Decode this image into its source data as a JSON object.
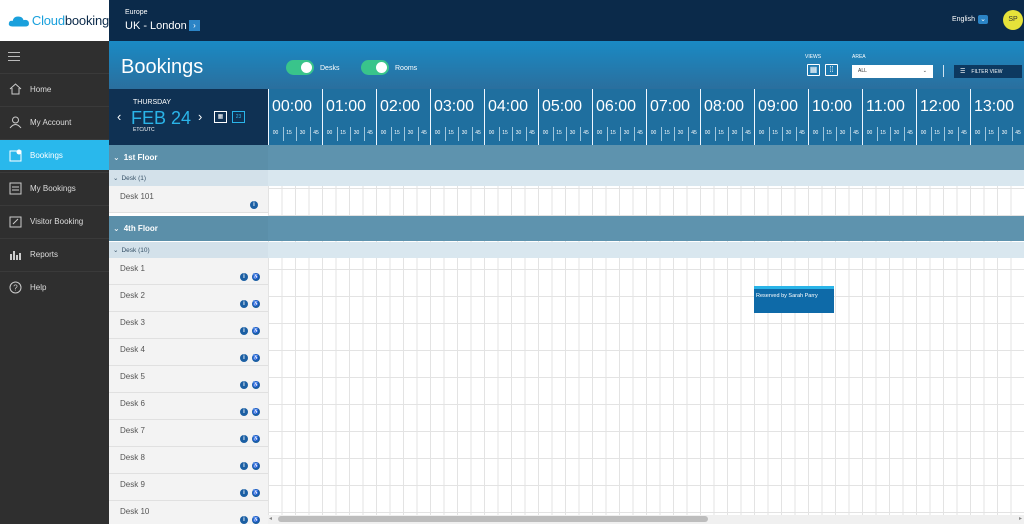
{
  "brand": {
    "logo_a": "Cloud",
    "logo_b": "booking"
  },
  "topbar": {
    "region_small": "Europe",
    "region_name": "UK - London",
    "language": "English",
    "user_initials": "SP"
  },
  "sidebar": {
    "items": [
      {
        "label": "Home",
        "icon": "home-icon"
      },
      {
        "label": "My Account",
        "icon": "user-icon"
      },
      {
        "label": "Bookings",
        "icon": "bookings-icon",
        "active": true
      },
      {
        "label": "My Bookings",
        "icon": "my-bookings-icon"
      },
      {
        "label": "Visitor Booking",
        "icon": "visitor-icon"
      },
      {
        "label": "Reports",
        "icon": "reports-icon"
      },
      {
        "label": "Help",
        "icon": "help-icon"
      }
    ]
  },
  "header": {
    "title": "Bookings",
    "toggle_desks": "Desks",
    "toggle_rooms": "Rooms",
    "views_label": "VIEWS",
    "area_label": "AREA",
    "area_value": "ALL",
    "filter_label": "FILTER VIEW"
  },
  "date": {
    "weekday": "THURSDAY",
    "date": "FEB 24",
    "timezone": "ETC/UTC",
    "cal_day": "23"
  },
  "timeline": {
    "hours": [
      "00:00",
      "01:00",
      "02:00",
      "03:00",
      "04:00",
      "05:00",
      "06:00",
      "07:00",
      "08:00",
      "09:00",
      "10:00",
      "11:00",
      "12:00",
      "13:00"
    ],
    "quarters": [
      "00",
      "15",
      "30",
      "45"
    ]
  },
  "floors": [
    {
      "name": "1st Floor",
      "type": "Desk (1)",
      "desks": [
        "Desk 101"
      ]
    },
    {
      "name": "4th Floor",
      "type": "Desk (10)",
      "desks": [
        "Desk 1",
        "Desk 2",
        "Desk 3",
        "Desk 4",
        "Desk 5",
        "Desk 6",
        "Desk 7",
        "Desk 8",
        "Desk 9",
        "Desk 10"
      ]
    }
  ],
  "booking": {
    "label": "Reserved by Sarah Parry"
  },
  "colors": {
    "accent": "#29b8ec",
    "navy": "#0b2a4a",
    "header": "#1a8ac4",
    "toggle": "#39c48b",
    "booking": "#0e6aa8"
  }
}
